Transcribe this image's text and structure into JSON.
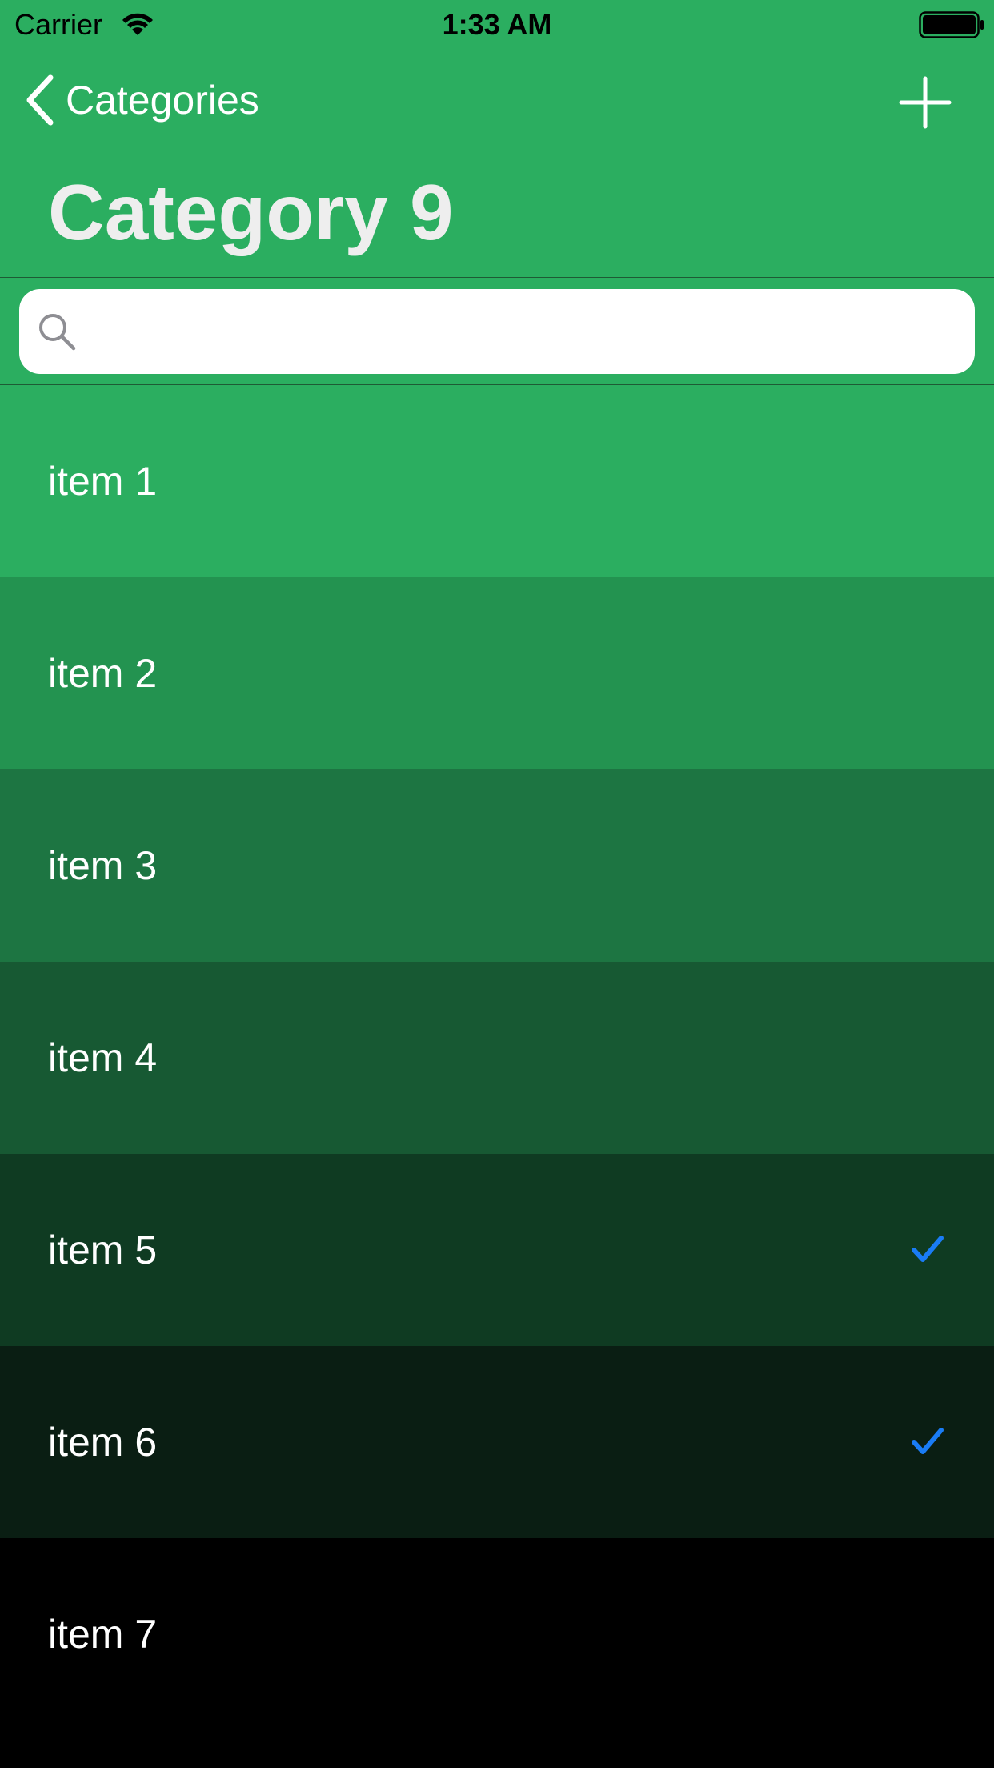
{
  "status_bar": {
    "carrier": "Carrier",
    "time": "1:33 AM"
  },
  "nav": {
    "back_label": "Categories",
    "back_icon": "chevron-left-icon",
    "add_icon": "plus-icon",
    "title": "Category 9"
  },
  "search": {
    "placeholder": "",
    "value": "",
    "icon": "search-icon"
  },
  "colors": {
    "header": "#2BAE60",
    "text": "#FFFFFF",
    "title": "#EEEEEE",
    "checkmark": "#1A7CF5"
  },
  "items": [
    {
      "label": "item 1",
      "checked": false,
      "color": "#2BAE60"
    },
    {
      "label": "item 2",
      "checked": false,
      "color": "#239350"
    },
    {
      "label": "item 3",
      "checked": false,
      "color": "#1D7542"
    },
    {
      "label": "item 4",
      "checked": false,
      "color": "#175933"
    },
    {
      "label": "item 5",
      "checked": true,
      "color": "#0F3B22"
    },
    {
      "label": "item 6",
      "checked": true,
      "color": "#0A1E13"
    },
    {
      "label": "item 7",
      "checked": false,
      "color": "#000000"
    }
  ]
}
